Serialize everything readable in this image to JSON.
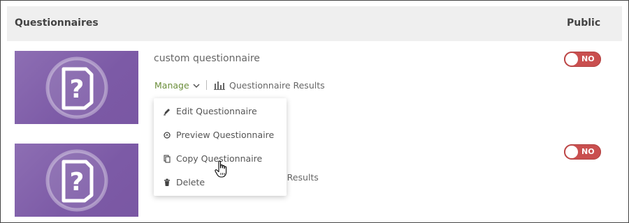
{
  "header": {
    "questionnaires_label": "Questionnaires",
    "public_label": "Public"
  },
  "rows": [
    {
      "title": "custom questionnaire",
      "manage_label": "Manage",
      "results_label": "Questionnaire Results",
      "public_toggle": "NO"
    },
    {
      "results_partial": "e Results",
      "public_toggle": "NO"
    }
  ],
  "manage_menu": {
    "items": [
      {
        "label": "Edit Questionnaire",
        "icon": "pencil-icon"
      },
      {
        "label": "Preview Questionnaire",
        "icon": "preview-icon"
      },
      {
        "label": "Copy Questionnaire",
        "icon": "copy-icon"
      },
      {
        "label": "Delete",
        "icon": "trash-icon"
      }
    ]
  },
  "colors": {
    "thumbnail_purple": "#7c5aa6",
    "manage_green": "#6b8e3a",
    "toggle_red": "#c94f4f",
    "header_bg": "#efefef"
  }
}
